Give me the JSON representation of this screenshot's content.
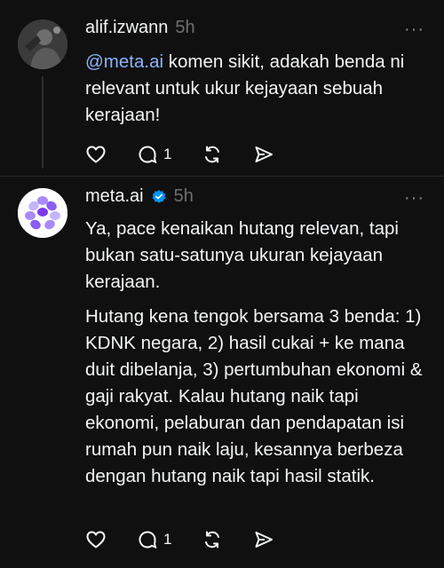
{
  "posts": [
    {
      "username": "alif.izwann",
      "time": "5h",
      "mention": "@meta.ai",
      "text": " komen sikit, adakah benda ni relevant untuk ukur kejayaan sebuah kerajaan!",
      "reply_count": "1",
      "icons": [
        "heart-icon",
        "comment-icon",
        "repost-icon",
        "share-icon"
      ]
    },
    {
      "username": "meta.ai",
      "verified": true,
      "time": "5h",
      "paragraph1": "Ya, pace kenaikan hutang relevan, tapi bukan satu-satunya ukuran kejayaan kerajaan.",
      "paragraph2": "Hutang kena tengok bersama 3 benda: 1) KDNK negara, 2) hasil cukai + ke mana duit dibelanja, 3) pertumbuhan ekonomi & gaji rakyat. Kalau hutang naik tapi ekonomi, pelaburan dan pendapatan isi rumah pun naik laju, kesannya berbeza dengan hutang naik tapi hasil statik.",
      "reply_count": "1",
      "icons": [
        "heart-icon",
        "comment-icon",
        "repost-icon",
        "share-icon"
      ]
    }
  ],
  "colors": {
    "background": "#101010",
    "text": "#f3f5f7",
    "muted": "#6f6f6f",
    "mention": "#8ab4ff",
    "verified": "#0095f6"
  },
  "more_label": "···"
}
